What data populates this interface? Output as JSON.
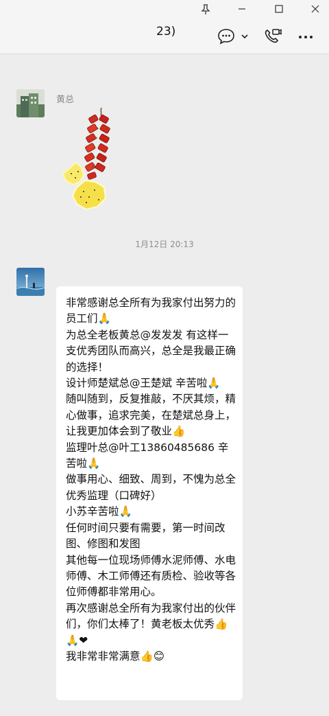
{
  "window": {
    "title": "23)",
    "controls": {
      "pin_icon": "pin-icon",
      "minimize_icon": "minimize-icon",
      "maximize_icon": "maximize-icon",
      "close_icon": "close-icon"
    }
  },
  "header": {
    "icons": [
      "chat-bubble-icon",
      "chevron-down-icon",
      "video-call-icon",
      "more-icon"
    ]
  },
  "messages": [
    {
      "sender": "黄总",
      "type": "sticker",
      "sticker": "firecracker-sticker"
    },
    {
      "timestamp": "1月12日 20:13"
    },
    {
      "type": "text",
      "text": "非常感谢总全所有为我家付出努力的员工们🙏\n为总全老板黄总@发发发 有这样一支优秀团队而高兴，总全是我最正确的选择！\n设计师楚斌总@王楚斌 辛苦啦🙏\n随叫随到，反复推敲，不厌其烦，精心做事，追求完美，在楚斌总身上，让我更加体会到了敬业👍\n监理叶总@叶工13860485686 辛苦啦🙏\n做事用心、细致、周到，不愧为总全优秀监理（口碑好）\n小苏辛苦啦🙏\n任何时间只要有需要，第一时间改图、修图和发图\n其他每一位现场师傅水泥师傅、水电师傅、木工师傅还有质检、验收等各位师傅都非常用心。\n再次感谢总全所有为我家付出的伙伴们，你们太棒了！黄老板太优秀👍🙏❤\n我非常非常满意👍😊"
    }
  ],
  "colors": {
    "chat_background": "#ededed",
    "bubble": "#ffffff",
    "timestamp_text": "#8e8e8e"
  }
}
